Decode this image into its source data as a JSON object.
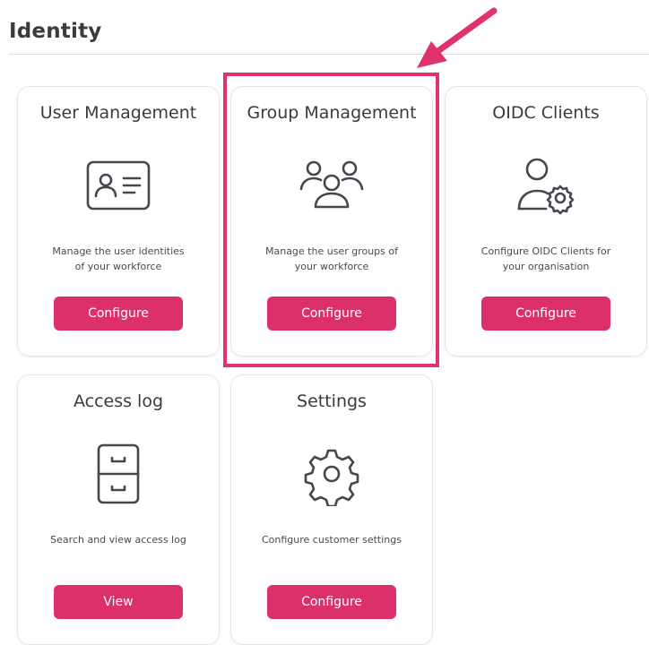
{
  "section": {
    "title": "Identity"
  },
  "cards": [
    {
      "title": "User Management",
      "icon": "id-card-icon",
      "description_lines": [
        "Manage the user identities",
        "of your workforce"
      ],
      "button_label": "Configure"
    },
    {
      "title": "Group Management",
      "icon": "user-group-icon",
      "description_lines": [
        "Manage the user groups of",
        "your workforce"
      ],
      "button_label": "Configure"
    },
    {
      "title": "OIDC Clients",
      "icon": "user-gear-icon",
      "description_lines": [
        "Configure OIDC Clients for",
        "your organisation"
      ],
      "button_label": "Configure"
    },
    {
      "title": "Access log",
      "icon": "file-cabinet-icon",
      "description_lines": [
        "Search and view access log"
      ],
      "button_label": "View"
    },
    {
      "title": "Settings",
      "icon": "gear-icon",
      "description_lines": [
        "Configure customer settings"
      ],
      "button_label": "Configure"
    }
  ],
  "colors": {
    "accent": "#dc3168",
    "highlight": "#e0336d",
    "text": "#3b3b3b",
    "icon_stroke": "#44474d"
  }
}
